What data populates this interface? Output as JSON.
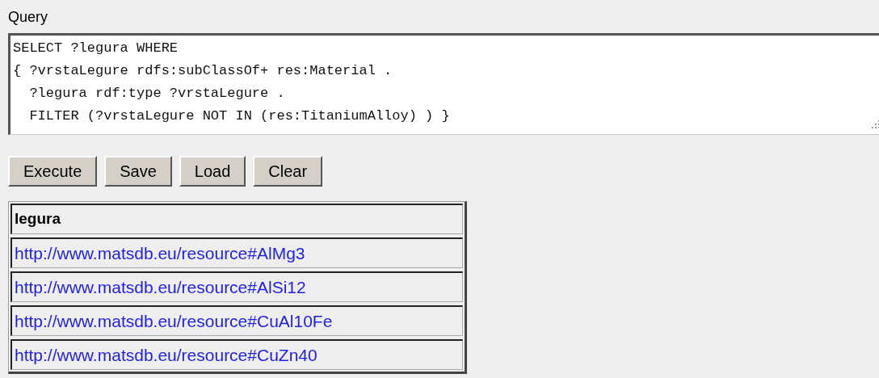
{
  "query": {
    "label": "Query",
    "lines": [
      "SELECT ?legura WHERE",
      "{ ?vrstaLegure rdfs:subClassOf+ res:Material .",
      "  ?legura rdf:type ?vrstaLegure .",
      "  FILTER (?vrstaLegure NOT IN (res:TitaniumAlloy) ) }"
    ]
  },
  "buttons": [
    "Execute",
    "Save",
    "Load",
    "Clear"
  ],
  "results": {
    "columns": [
      "legura"
    ],
    "rows": [
      [
        "http://www.matsdb.eu/resource#AlMg3"
      ],
      [
        "http://www.matsdb.eu/resource#AlSi12"
      ],
      [
        "http://www.matsdb.eu/resource#CuAl10Fe"
      ],
      [
        "http://www.matsdb.eu/resource#CuZn40"
      ]
    ]
  }
}
